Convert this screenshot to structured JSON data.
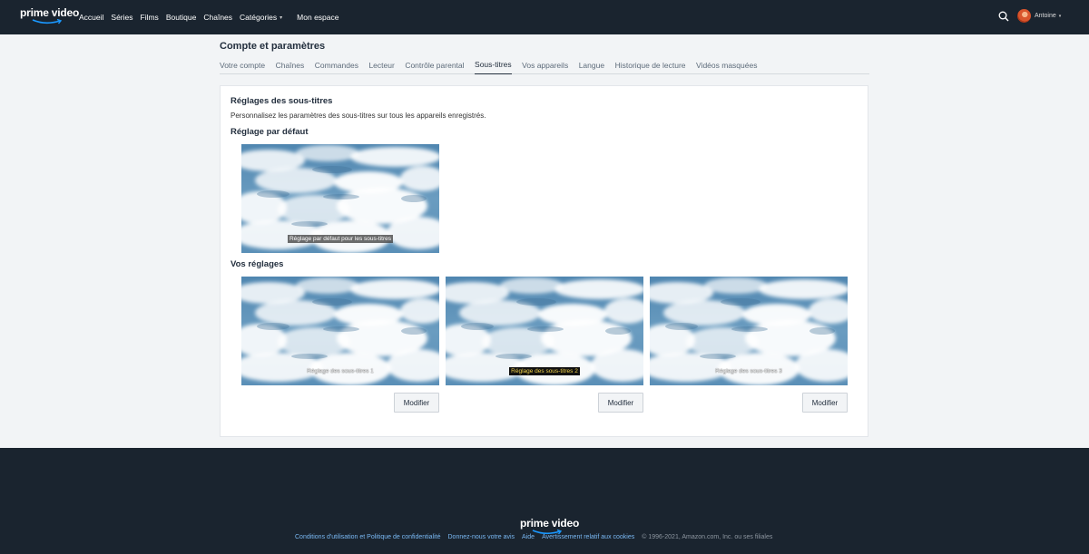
{
  "brand": {
    "logo_text": "prime video"
  },
  "nav": {
    "items": [
      {
        "label": "Accueil"
      },
      {
        "label": "Séries"
      },
      {
        "label": "Films"
      },
      {
        "label": "Boutique"
      },
      {
        "label": "Chaînes"
      },
      {
        "label": "Catégories"
      },
      {
        "label": "Mon espace"
      }
    ],
    "caret": "▾"
  },
  "profile": {
    "name": "Antoine",
    "caret": "▾"
  },
  "icons": {
    "search": "search-icon",
    "avatar": "avatar",
    "logo": "prime-video-logo"
  },
  "page": {
    "title": "Compte et paramètres"
  },
  "tabs": [
    {
      "label": "Votre compte"
    },
    {
      "label": "Chaînes"
    },
    {
      "label": "Commandes"
    },
    {
      "label": "Lecteur"
    },
    {
      "label": "Contrôle parental"
    },
    {
      "label": "Sous-titres",
      "active": true
    },
    {
      "label": "Vos appareils"
    },
    {
      "label": "Langue"
    },
    {
      "label": "Historique de lecture"
    },
    {
      "label": "Vidéos masquées"
    }
  ],
  "panel": {
    "title": "Réglages des sous-titres",
    "description": "Personnalisez les paramètres des sous-titres sur tous les appareils enregistrés.",
    "default_section": {
      "title": "Réglage par défaut",
      "preview_caption": "Réglage par défaut pour les sous-titres"
    },
    "custom_section": {
      "title": "Vos réglages",
      "presets": [
        {
          "caption": "Réglage des sous-titres 1",
          "button": "Modifier"
        },
        {
          "caption": "Réglage des sous-titres 2",
          "button": "Modifier"
        },
        {
          "caption": "Réglage des sous-titres 3",
          "button": "Modifier"
        }
      ]
    }
  },
  "footer": {
    "logo_text": "prime video",
    "links": [
      {
        "label": "Conditions d'utilisation et Politique de confidentialité"
      },
      {
        "label": "Donnez-nous votre avis"
      },
      {
        "label": "Aide"
      },
      {
        "label": "Avertissement relatif aux cookies"
      }
    ],
    "copyright": "© 1996-2021, Amazon.com, Inc. ou ses filiales"
  },
  "colors": {
    "header_bg": "#1a242f",
    "page_bg": "#f2f4f6",
    "link_blue": "#79b8f3",
    "caption_yellow": "#f2d24a"
  }
}
